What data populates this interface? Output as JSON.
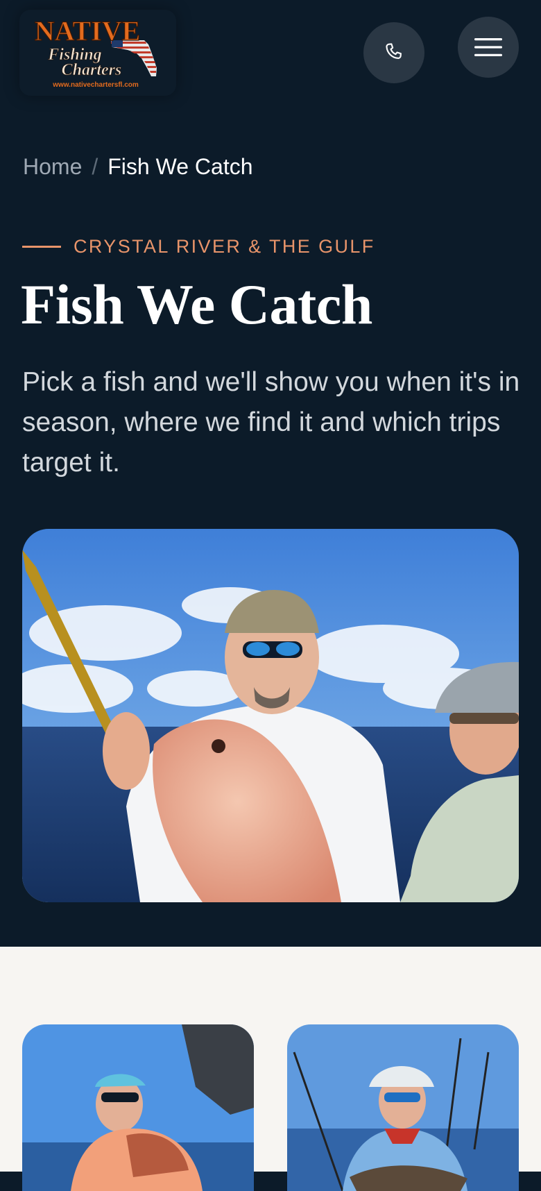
{
  "header": {
    "logo": {
      "name_top": "NATIVE",
      "name_line2": "Fishing",
      "name_line3": "Charters",
      "url": "www.nativechartersfl.com"
    },
    "phone_icon": "phone-icon",
    "menu_icon": "hamburger-menu-icon"
  },
  "breadcrumb": {
    "home": "Home",
    "separator": "/",
    "current": "Fish We Catch"
  },
  "hero": {
    "eyebrow": "CRYSTAL RIVER & THE GULF",
    "title": "Fish We Catch",
    "intro": "Pick a fish and we'll show you when it's in season, where we find it and which trips target it."
  },
  "colors": {
    "navy": "#0c1b29",
    "accent": "#e8946a",
    "light_bg": "#f7f5f2"
  }
}
